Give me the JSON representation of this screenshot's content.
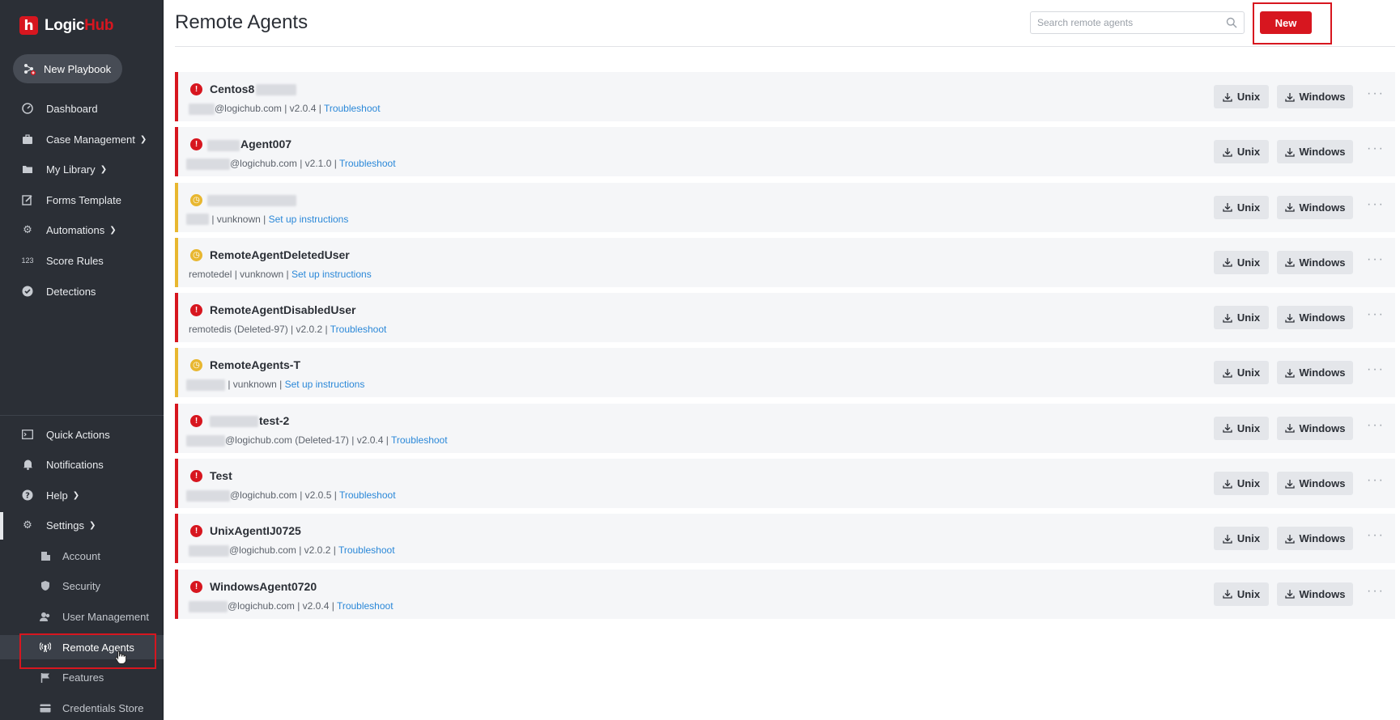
{
  "app": {
    "logo_main": "Logic",
    "logo_accent": "Hub"
  },
  "sidebar": {
    "new_playbook": "New Playbook",
    "items": [
      {
        "label": "Dashboard"
      },
      {
        "label": "Case Management"
      },
      {
        "label": "My Library"
      },
      {
        "label": "Forms Template"
      },
      {
        "label": "Automations"
      },
      {
        "label": "Score Rules"
      },
      {
        "label": "Detections"
      }
    ],
    "score_rules_icon_text": "123",
    "bottom_items": [
      {
        "label": "Quick Actions"
      },
      {
        "label": "Notifications"
      },
      {
        "label": "Help"
      },
      {
        "label": "Settings"
      }
    ],
    "settings_sub": [
      {
        "label": "Account"
      },
      {
        "label": "Security"
      },
      {
        "label": "User Management"
      },
      {
        "label": "Remote Agents"
      },
      {
        "label": "Features"
      },
      {
        "label": "Credentials Store"
      }
    ]
  },
  "header": {
    "title": "Remote Agents",
    "search_placeholder": "Search remote agents",
    "new_button": "New"
  },
  "buttons": {
    "unix": "Unix",
    "windows": "Windows",
    "more": "···"
  },
  "agents": [
    {
      "status": "error",
      "name": "Centos8",
      "meta": "@logichub.com | v2.0.4 | ",
      "link": "Troubleshoot"
    },
    {
      "status": "error",
      "name": "Agent007",
      "meta": "@logichub.com | v2.1.0 | ",
      "link": "Troubleshoot"
    },
    {
      "status": "pending",
      "name": "",
      "meta": " | vunknown | ",
      "link": "Set up instructions"
    },
    {
      "status": "pending",
      "name": "RemoteAgentDeletedUser",
      "meta": "remotedel | vunknown | ",
      "link": "Set up instructions"
    },
    {
      "status": "error",
      "name": "RemoteAgentDisabledUser",
      "meta": "remotedis (Deleted-97) | v2.0.2 | ",
      "link": "Troubleshoot"
    },
    {
      "status": "pending",
      "name": "RemoteAgents-T",
      "meta": " | vunknown | ",
      "link": "Set up instructions"
    },
    {
      "status": "error",
      "name": "test-2",
      "meta": "@logichub.com (Deleted-17) | v2.0.4 | ",
      "link": "Troubleshoot"
    },
    {
      "status": "error",
      "name": "Test",
      "meta": "@logichub.com | v2.0.5 | ",
      "link": "Troubleshoot"
    },
    {
      "status": "error",
      "name": "UnixAgentIJ0725",
      "meta": "@logichub.com | v2.0.2 | ",
      "link": "Troubleshoot"
    },
    {
      "status": "error",
      "name": "WindowsAgent0720",
      "meta": "@logichub.com | v2.0.4 | ",
      "link": "Troubleshoot"
    }
  ],
  "colors": {
    "accent": "#d7161f",
    "pending": "#e8b730",
    "link": "#2b88d8",
    "sidebar_bg": "#2b2f36"
  }
}
